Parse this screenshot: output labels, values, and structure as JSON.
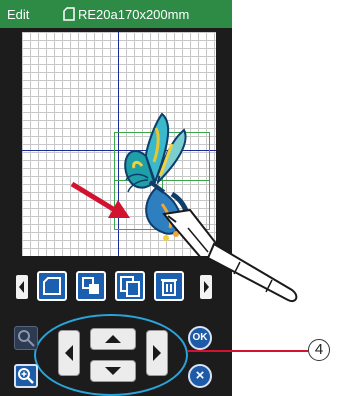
{
  "titlebar": {
    "mode": "Edit",
    "hoop": "RE20a170x200mm"
  },
  "controls": {
    "ok_label": "OK",
    "cancel_label": "×",
    "callout_number": "4"
  },
  "colors": {
    "accent_green": "#2e8b46",
    "button_blue": "#1b5fb0",
    "ring_cyan": "#2aa3d9",
    "callout_red": "#d3122f"
  },
  "icons": [
    "hoop-icon",
    "arrow-left-icon",
    "arrow-right-icon",
    "arrow-up-icon",
    "arrow-down-icon",
    "zoom-icon",
    "magnify-glass-icon",
    "layout-icon",
    "rotate-icon",
    "copy-icon",
    "delete-icon"
  ]
}
